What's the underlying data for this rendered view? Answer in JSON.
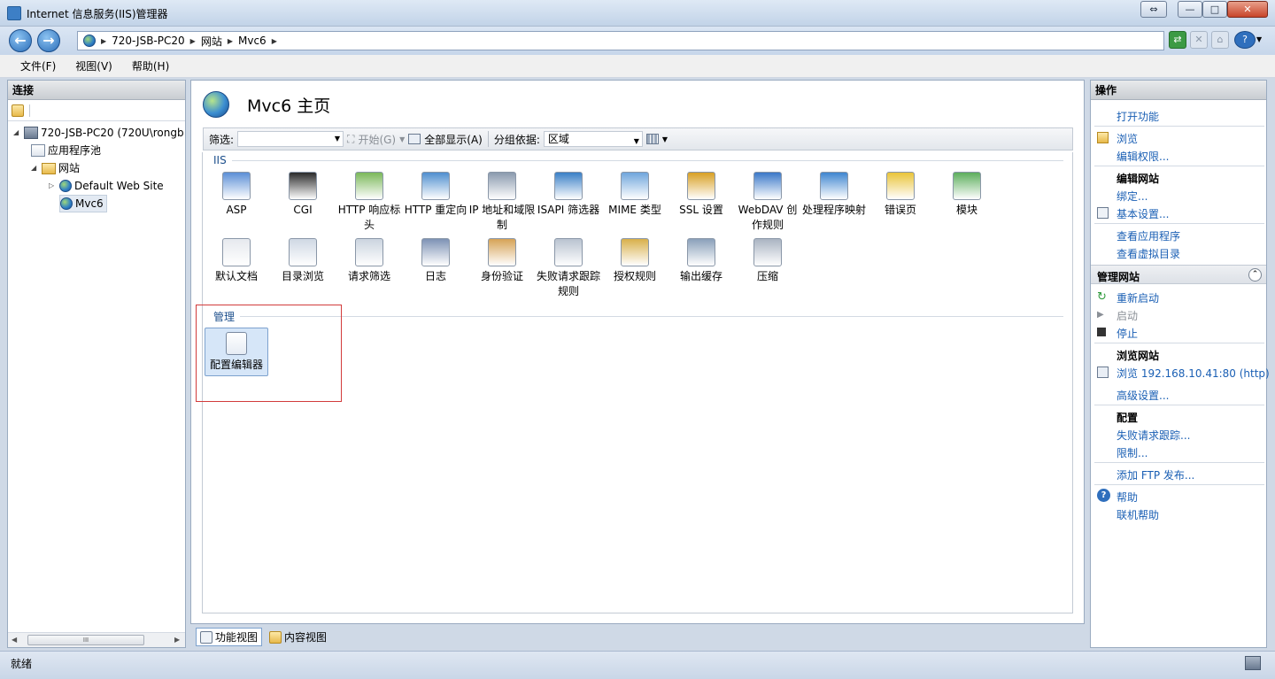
{
  "window": {
    "title": "Internet 信息服务(IIS)管理器",
    "restore": "⇔",
    "min": "—",
    "max": "□",
    "close": "✕"
  },
  "nav": {
    "back": "←",
    "forward": "→",
    "breadcrumb": [
      "720-JSB-PC20",
      "网站",
      "Mvc6"
    ]
  },
  "menu": [
    "文件(F)",
    "视图(V)",
    "帮助(H)"
  ],
  "connections": {
    "title": "连接",
    "tree": [
      "720-JSB-PC20 (720U\\rongb",
      "应用程序池",
      "网站",
      "Default Web Site",
      "Mvc6"
    ]
  },
  "main": {
    "title": "Mvc6 主页",
    "filter": {
      "label": "筛选:",
      "start": "开始(G)",
      "show_all": "全部显示(A)",
      "group_by_label": "分组依据:",
      "group_by_value": "区域"
    },
    "groups": [
      {
        "name": "IIS",
        "items": [
          {
            "label": "ASP",
            "icon": "asp-icon"
          },
          {
            "label": "CGI",
            "icon": "cgi-icon"
          },
          {
            "label": "HTTP 响应标头",
            "icon": "http-headers-icon"
          },
          {
            "label": "HTTP 重定向",
            "icon": "http-redirect-icon"
          },
          {
            "label": "IP 地址和域限制",
            "icon": "ip-restrictions-icon"
          },
          {
            "label": "ISAPI 筛选器",
            "icon": "isapi-filter-icon"
          },
          {
            "label": "MIME 类型",
            "icon": "mime-icon"
          },
          {
            "label": "SSL 设置",
            "icon": "lock-icon"
          },
          {
            "label": "WebDAV 创作规则",
            "icon": "webdav-icon"
          },
          {
            "label": "处理程序映射",
            "icon": "handler-mappings-icon"
          },
          {
            "label": "错误页",
            "icon": "error-pages-icon"
          },
          {
            "label": "模块",
            "icon": "modules-icon"
          },
          {
            "label": "默认文档",
            "icon": "default-document-icon"
          },
          {
            "label": "目录浏览",
            "icon": "directory-browsing-icon"
          },
          {
            "label": "请求筛选",
            "icon": "request-filtering-icon"
          },
          {
            "label": "日志",
            "icon": "logging-icon"
          },
          {
            "label": "身份验证",
            "icon": "authentication-icon"
          },
          {
            "label": "失败请求跟踪规则",
            "icon": "failed-request-icon"
          },
          {
            "label": "授权规则",
            "icon": "authorization-icon"
          },
          {
            "label": "输出缓存",
            "icon": "output-cache-icon"
          },
          {
            "label": "压缩",
            "icon": "compression-icon"
          }
        ]
      },
      {
        "name": "管理",
        "items": [
          {
            "label": "配置编辑器",
            "icon": "config-editor-icon"
          }
        ]
      }
    ],
    "view_tabs": [
      "功能视图",
      "内容视图"
    ]
  },
  "actions": {
    "title": "操作",
    "open_feature": "打开功能",
    "browse": "浏览",
    "edit_permissions": "编辑权限...",
    "edit_site_header": "编辑网站",
    "bindings": "绑定...",
    "basic_settings": "基本设置...",
    "view_apps": "查看应用程序",
    "view_vdirs": "查看虚拟目录",
    "manage_site_header": "管理网站",
    "restart": "重新启动",
    "start": "启动",
    "stop": "停止",
    "browse_site_header": "浏览网站",
    "browse_url": "浏览 192.168.10.41:80 (http)",
    "advanced_settings": "高级设置...",
    "configure_header": "配置",
    "failed_request_tracing": "失败请求跟踪...",
    "limits": "限制...",
    "add_ftp": "添加 FTP 发布...",
    "help": "帮助",
    "online_help": "联机帮助"
  },
  "status": {
    "text": "就绪"
  },
  "colors": {
    "link": "#1a5fb4",
    "highlight_box": "#d23b3b",
    "selected_bg": "#d6e6f8"
  }
}
